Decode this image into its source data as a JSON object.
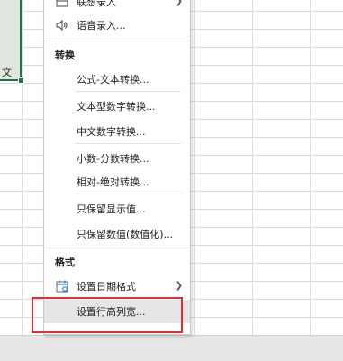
{
  "sheet": {
    "cell_text": "文"
  },
  "menu": {
    "item_lianxiang": "联想录入",
    "item_yuyin": "语音录入...",
    "section_convert": "转换",
    "convert_items": [
      "公式-文本转换...",
      "文本型数字转换...",
      "中文数字转换...",
      "小数-分数转换...",
      "相对-绝对转换...",
      "只保留显示值...",
      "只保留数值(数值化)..."
    ],
    "section_format": "格式",
    "item_date_format": "设置日期格式",
    "item_row_col": "设置行高列宽..."
  },
  "colors": {
    "highlight_border": "#e03030",
    "excel_green": "#217346"
  }
}
